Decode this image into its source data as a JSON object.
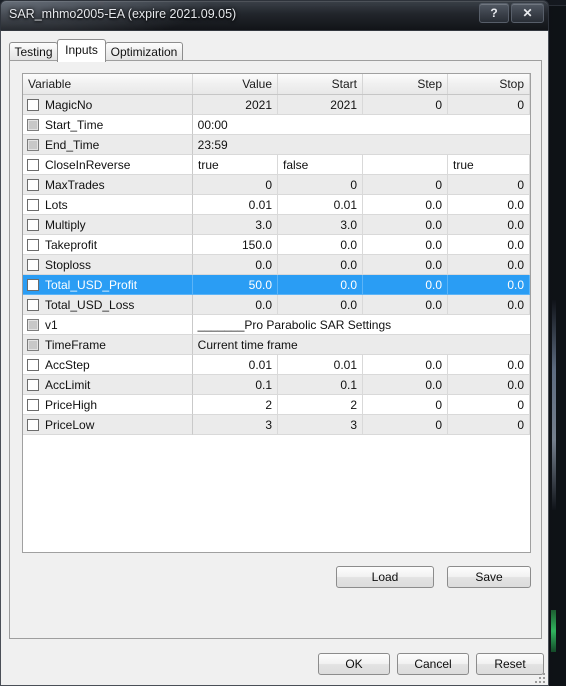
{
  "window": {
    "title": "SAR_mhmo2005-EA (expire 2021.09.05)",
    "help_button": "?",
    "close_button": "✕",
    "accent_selection": "#2a9df4",
    "row_shade": "#ebebeb"
  },
  "tabs": [
    {
      "label": "Testing",
      "active": false
    },
    {
      "label": "Inputs",
      "active": true
    },
    {
      "label": "Optimization",
      "active": false
    }
  ],
  "table": {
    "columns": [
      "Variable",
      "Value",
      "Start",
      "Step",
      "Stop"
    ],
    "selected_row": "Total_USD_Profit",
    "rows": [
      {
        "variable": "MagicNo",
        "checkbox": "unchecked",
        "value": "2021",
        "start": "2021",
        "step": "0",
        "stop": "0",
        "span": false,
        "selected": false
      },
      {
        "variable": "Start_Time",
        "checkbox": "disabled",
        "value": "00:00",
        "start": "",
        "step": "",
        "stop": "",
        "span": true,
        "selected": false
      },
      {
        "variable": "End_Time",
        "checkbox": "disabled",
        "value": "23:59",
        "start": "",
        "step": "",
        "stop": "",
        "span": true,
        "selected": false
      },
      {
        "variable": "CloseInReverse",
        "checkbox": "unchecked",
        "value": "true",
        "start": "false",
        "step": "",
        "stop": "true",
        "span": false,
        "selected": false,
        "align": "left"
      },
      {
        "variable": "MaxTrades",
        "checkbox": "unchecked",
        "value": "0",
        "start": "0",
        "step": "0",
        "stop": "0",
        "span": false,
        "selected": false
      },
      {
        "variable": "Lots",
        "checkbox": "unchecked",
        "value": "0.01",
        "start": "0.01",
        "step": "0.0",
        "stop": "0.0",
        "span": false,
        "selected": false
      },
      {
        "variable": "Multiply",
        "checkbox": "unchecked",
        "value": "3.0",
        "start": "3.0",
        "step": "0.0",
        "stop": "0.0",
        "span": false,
        "selected": false
      },
      {
        "variable": "Takeprofit",
        "checkbox": "unchecked",
        "value": "150.0",
        "start": "0.0",
        "step": "0.0",
        "stop": "0.0",
        "span": false,
        "selected": false
      },
      {
        "variable": "Stoploss",
        "checkbox": "unchecked",
        "value": "0.0",
        "start": "0.0",
        "step": "0.0",
        "stop": "0.0",
        "span": false,
        "selected": false
      },
      {
        "variable": "Total_USD_Profit",
        "checkbox": "unchecked",
        "value": "50.0",
        "start": "0.0",
        "step": "0.0",
        "stop": "0.0",
        "span": false,
        "selected": true
      },
      {
        "variable": "Total_USD_Loss",
        "checkbox": "unchecked",
        "value": "0.0",
        "start": "0.0",
        "step": "0.0",
        "stop": "0.0",
        "span": false,
        "selected": false
      },
      {
        "variable": "v1",
        "checkbox": "disabled",
        "value": "_______Pro Parabolic SAR Settings",
        "start": "",
        "step": "",
        "stop": "",
        "span": true,
        "selected": false
      },
      {
        "variable": "TimeFrame",
        "checkbox": "disabled",
        "value": "Current time frame",
        "start": "",
        "step": "",
        "stop": "",
        "span": true,
        "selected": false
      },
      {
        "variable": "AccStep",
        "checkbox": "unchecked",
        "value": "0.01",
        "start": "0.01",
        "step": "0.0",
        "stop": "0.0",
        "span": false,
        "selected": false
      },
      {
        "variable": "AccLimit",
        "checkbox": "unchecked",
        "value": "0.1",
        "start": "0.1",
        "step": "0.0",
        "stop": "0.0",
        "span": false,
        "selected": false
      },
      {
        "variable": "PriceHigh",
        "checkbox": "unchecked",
        "value": "2",
        "start": "2",
        "step": "0",
        "stop": "0",
        "span": false,
        "selected": false
      },
      {
        "variable": "PriceLow",
        "checkbox": "unchecked",
        "value": "3",
        "start": "3",
        "step": "0",
        "stop": "0",
        "span": false,
        "selected": false
      }
    ]
  },
  "panel_buttons": {
    "load": "Load",
    "save": "Save"
  },
  "footer_buttons": {
    "ok": "OK",
    "cancel": "Cancel",
    "reset": "Reset"
  }
}
